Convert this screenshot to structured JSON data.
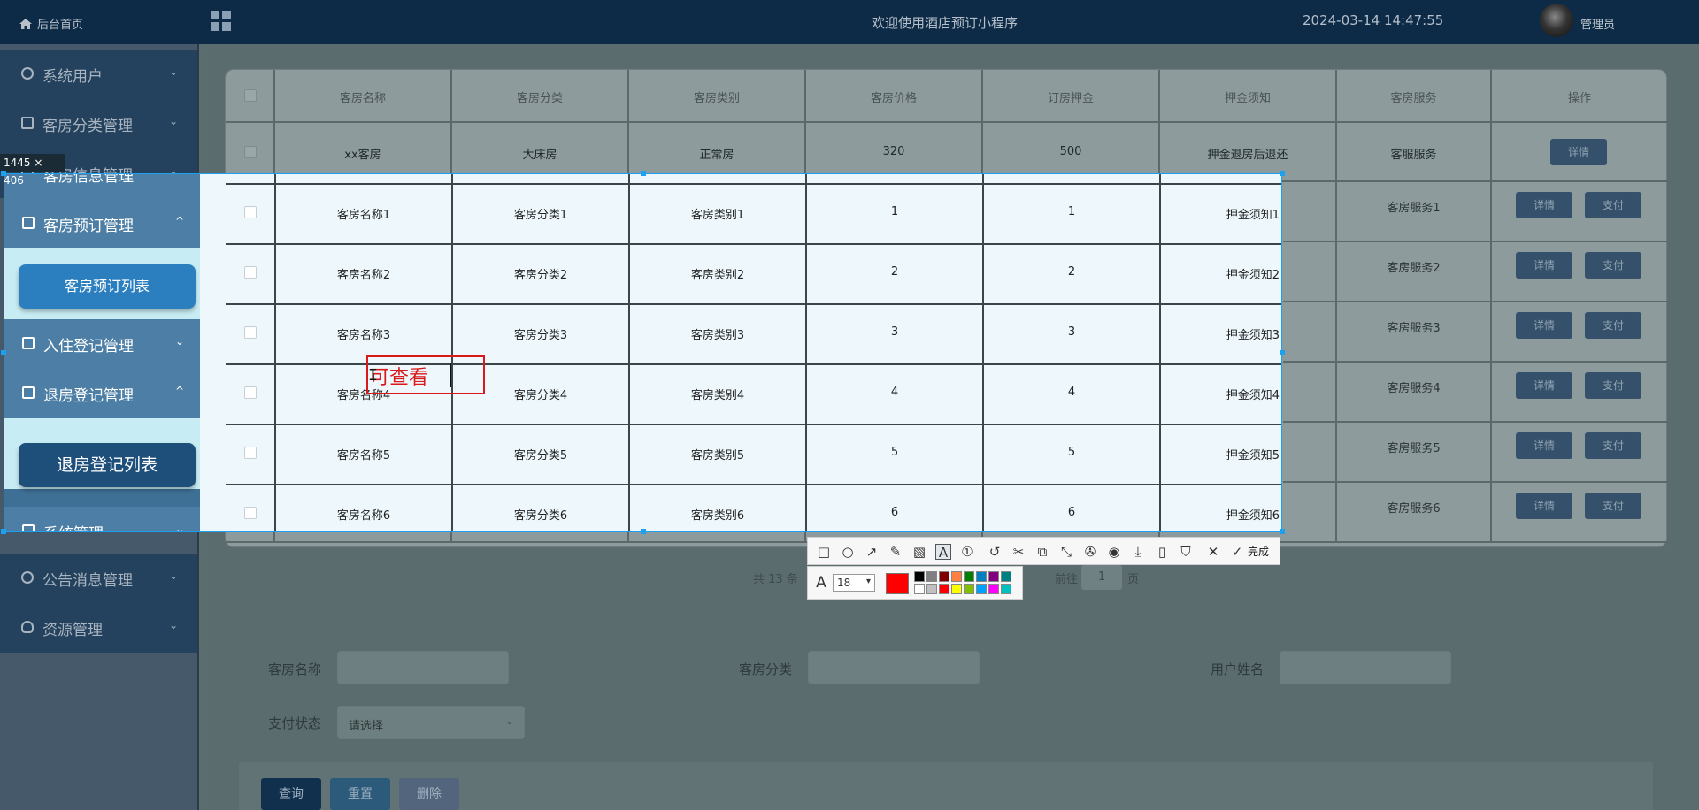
{
  "topbar": {
    "home": "后台首页",
    "title": "欢迎使用酒店预订小程序",
    "datetime": "2024-03-14 14:47:55",
    "user": "管理员"
  },
  "sidebar": {
    "items": [
      {
        "label": "系统用户",
        "icon": "user-icon",
        "chevron": "⌄"
      },
      {
        "label": "客房分类管理",
        "icon": "doc-icon",
        "chevron": "⌄"
      },
      {
        "label": "客房信息管理",
        "icon": "doc-icon",
        "chevron": "⌄"
      },
      {
        "label": "客房预订管理",
        "icon": "doc-icon",
        "chevron": "^",
        "sub": "客房预订列表"
      },
      {
        "label": "入住登记管理",
        "icon": "doc-icon",
        "chevron": "⌄"
      },
      {
        "label": "退房登记管理",
        "icon": "doc-icon",
        "chevron": "^",
        "sub": "退房登记列表"
      },
      {
        "label": "系统管理",
        "icon": "doc-icon",
        "chevron": "⌄"
      },
      {
        "label": "公告消息管理",
        "icon": "info-icon",
        "chevron": "⌄"
      },
      {
        "label": "资源管理",
        "icon": "bulb-icon",
        "chevron": "⌄"
      }
    ]
  },
  "table": {
    "headers": [
      "客房名称",
      "客房分类",
      "客房类别",
      "客房价格",
      "订房押金",
      "押金须知",
      "客房服务",
      "操作"
    ],
    "first_row": [
      "xx客房",
      "大床房",
      "正常房",
      "320",
      "500",
      "押金退房后退还",
      "客服服务"
    ],
    "rows": [
      [
        "客房名称1",
        "客房分类1",
        "客房类别1",
        "1",
        "1",
        "押金须知1",
        "客房服务1"
      ],
      [
        "客房名称2",
        "客房分类2",
        "客房类别2",
        "2",
        "2",
        "押金须知2",
        "客房服务2"
      ],
      [
        "客房名称3",
        "客房分类3",
        "客房类别3",
        "3",
        "3",
        "押金须知3",
        "客房服务3"
      ],
      [
        "客房名称4",
        "客房分类4",
        "客房类别4",
        "4",
        "4",
        "押金须知4",
        "客房服务4"
      ],
      [
        "客房名称5",
        "客房分类5",
        "客房类别5",
        "5",
        "5",
        "押金须知5",
        "客房服务5"
      ],
      [
        "客房名称6",
        "客房分类6",
        "客房类别6",
        "6",
        "6",
        "押金须知6",
        "客房服务6"
      ]
    ],
    "btn_detail": "详情",
    "btn_pay": "支付"
  },
  "pager": {
    "total": "共 13 条",
    "goto": "前往",
    "page": "1",
    "page_suffix": "页"
  },
  "search": {
    "room_name": "客房名称",
    "room_category": "客房分类",
    "user_name": "用户姓名",
    "pay_status": "支付状态",
    "pay_placeholder": "请选择"
  },
  "actions": {
    "query": "查询",
    "reset": "重置",
    "delete": "删除"
  },
  "capture": {
    "size": "1445 × 406",
    "annotation": "可查看",
    "font_size": "18",
    "done": "完成"
  },
  "colors": {
    "accent_red": "#ff0000",
    "selection_blue": "#1ea0f0",
    "swatches_top": [
      "#000000",
      "#808080",
      "#800000",
      "#ff8040",
      "#008000",
      "#0080c0",
      "#800080",
      "#008080"
    ],
    "swatches_bottom": [
      "#ffffff",
      "#c0c0c0",
      "#ff0000",
      "#ffff00",
      "#80c000",
      "#00a0ff",
      "#ff00ff",
      "#00c0c0"
    ]
  }
}
